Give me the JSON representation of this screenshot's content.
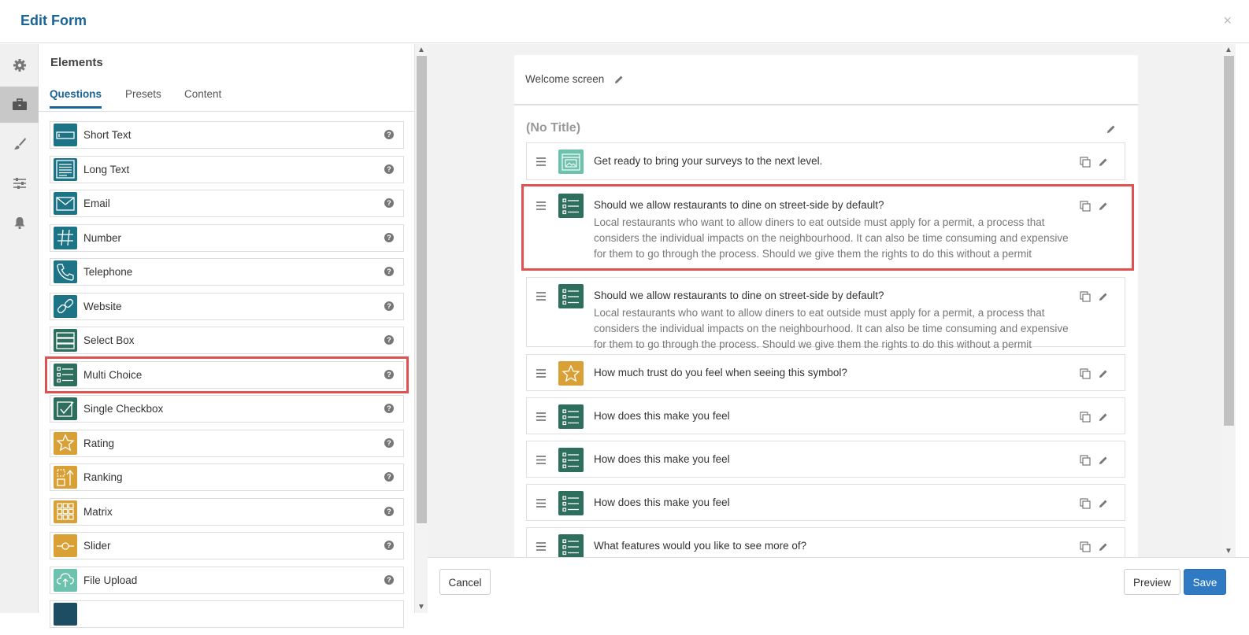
{
  "header": {
    "title": "Edit Form",
    "close_symbol": "×"
  },
  "rail": [
    {
      "icon": "gear-icon",
      "active": false
    },
    {
      "icon": "briefcase-icon",
      "active": true
    },
    {
      "icon": "brush-icon",
      "active": false
    },
    {
      "icon": "sliders-icon",
      "active": false
    },
    {
      "icon": "bell-icon",
      "active": false
    }
  ],
  "panel": {
    "title": "Elements",
    "tabs": [
      {
        "label": "Questions",
        "active": true
      },
      {
        "label": "Presets",
        "active": false
      },
      {
        "label": "Content",
        "active": false
      }
    ],
    "elements": [
      {
        "label": "Short Text",
        "icon": "short-text-icon",
        "color": "#1e7487"
      },
      {
        "label": "Long Text",
        "icon": "long-text-icon",
        "color": "#1e7487"
      },
      {
        "label": "Email",
        "icon": "email-icon",
        "color": "#1e7487"
      },
      {
        "label": "Number",
        "icon": "hash-icon",
        "color": "#1e7487"
      },
      {
        "label": "Telephone",
        "icon": "phone-icon",
        "color": "#1e7487"
      },
      {
        "label": "Website",
        "icon": "link-icon",
        "color": "#1e7487"
      },
      {
        "label": "Select Box",
        "icon": "select-box-icon",
        "color": "#2d6f5c"
      },
      {
        "label": "Multi Choice",
        "icon": "multi-choice-icon",
        "color": "#2d6f5c",
        "highlighted": true
      },
      {
        "label": "Single Checkbox",
        "icon": "checkbox-icon",
        "color": "#2d6f5c"
      },
      {
        "label": "Rating",
        "icon": "star-icon",
        "color": "#d9a036"
      },
      {
        "label": "Ranking",
        "icon": "ranking-icon",
        "color": "#d9a036"
      },
      {
        "label": "Matrix",
        "icon": "matrix-icon",
        "color": "#d9a036"
      },
      {
        "label": "Slider",
        "icon": "slider-icon",
        "color": "#d9a036"
      },
      {
        "label": "File Upload",
        "icon": "cloud-upload-icon",
        "color": "#6cc2ac"
      }
    ],
    "help_symbol": "?"
  },
  "form": {
    "welcome_label": "Welcome screen",
    "page_title": "(No Title)",
    "questions": [
      {
        "title": "Get ready to bring your surveys to the next level.",
        "icon": "image-content-icon",
        "color": "#6cc2ac"
      },
      {
        "title": "Should we allow restaurants to dine on street-side by default?",
        "description": "Local restaurants who want to allow diners to eat outside must apply for a permit, a process that considers the individual impacts on the neighbourhood. It can also be time consuming and expensive for them to go through the process. Should we give them the rights to do this without a permit",
        "icon": "multi-choice-icon",
        "color": "#2d6f5c",
        "highlighted": true
      },
      {
        "title": "Should we allow restaurants to dine on street-side by default?",
        "description": "Local restaurants who want to allow diners to eat outside must apply for a permit, a process that considers the individual impacts on the neighbourhood. It can also be time consuming and expensive for them to go through the process. Should we give them the rights to do this without a permit",
        "icon": "multi-choice-icon",
        "color": "#2d6f5c"
      },
      {
        "title": "How much trust do you feel when seeing this symbol?",
        "icon": "star-icon",
        "color": "#d9a036"
      },
      {
        "title": "How does this make you feel",
        "icon": "multi-choice-icon",
        "color": "#2d6f5c"
      },
      {
        "title": "How does this make you feel",
        "icon": "multi-choice-icon",
        "color": "#2d6f5c"
      },
      {
        "title": "How does this make you feel",
        "icon": "multi-choice-icon",
        "color": "#2d6f5c"
      },
      {
        "title": "What features would you like to see more of?",
        "icon": "multi-choice-icon",
        "color": "#2d6f5c"
      }
    ]
  },
  "footer": {
    "cancel_label": "Cancel",
    "preview_label": "Preview",
    "save_label": "Save"
  },
  "colors": {
    "accent": "#1a6496",
    "highlight": "#e05252",
    "primary_button": "#2f7ac2"
  }
}
